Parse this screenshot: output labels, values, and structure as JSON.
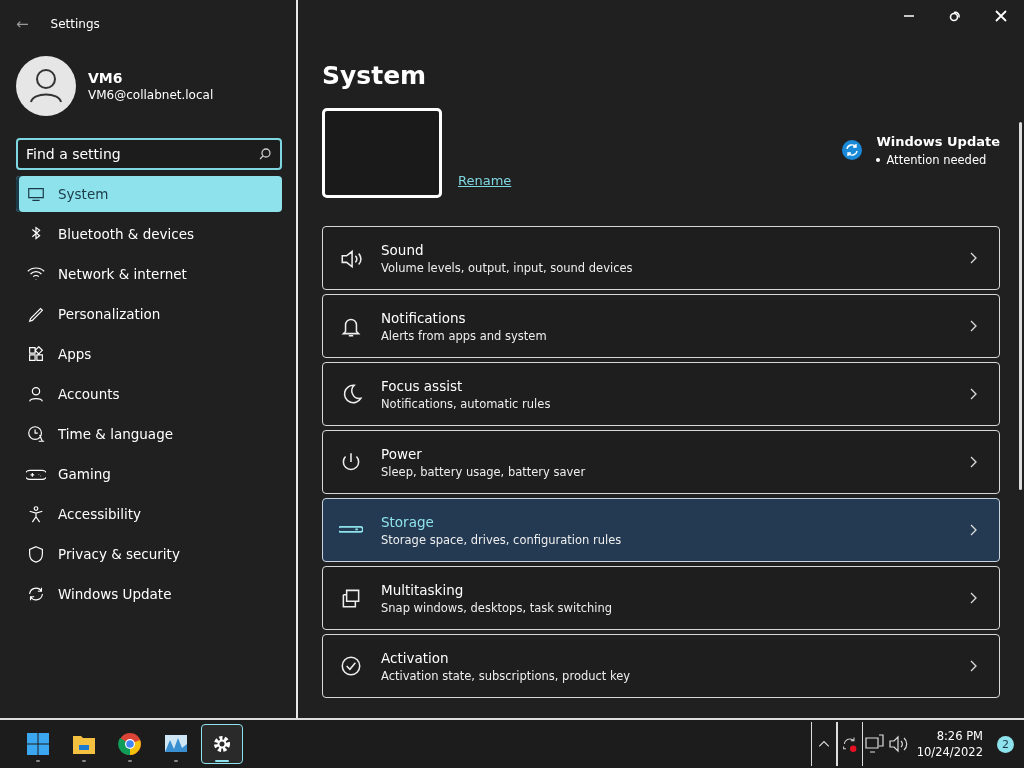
{
  "window": {
    "title": "Settings",
    "back": "←"
  },
  "account": {
    "name": "VM6",
    "email": "VM6@collabnet.local"
  },
  "search": {
    "placeholder": "Find a setting"
  },
  "nav": [
    {
      "label": "System",
      "selected": true
    },
    {
      "label": "Bluetooth & devices",
      "selected": false
    },
    {
      "label": "Network & internet",
      "selected": false
    },
    {
      "label": "Personalization",
      "selected": false
    },
    {
      "label": "Apps",
      "selected": false
    },
    {
      "label": "Accounts",
      "selected": false
    },
    {
      "label": "Time & language",
      "selected": false
    },
    {
      "label": "Gaming",
      "selected": false
    },
    {
      "label": "Accessibility",
      "selected": false
    },
    {
      "label": "Privacy & security",
      "selected": false
    },
    {
      "label": "Windows Update",
      "selected": false
    }
  ],
  "page": {
    "title": "System",
    "rename": "Rename"
  },
  "update": {
    "title": "Windows Update",
    "status": "Attention needed"
  },
  "cards": [
    {
      "title": "Sound",
      "subtitle": "Volume levels, output, input, sound devices",
      "selected": false
    },
    {
      "title": "Notifications",
      "subtitle": "Alerts from apps and system",
      "selected": false
    },
    {
      "title": "Focus assist",
      "subtitle": "Notifications, automatic rules",
      "selected": false
    },
    {
      "title": "Power",
      "subtitle": "Sleep, battery usage, battery saver",
      "selected": false
    },
    {
      "title": "Storage",
      "subtitle": "Storage space, drives, configuration rules",
      "selected": true
    },
    {
      "title": "Multitasking",
      "subtitle": "Snap windows, desktops, task switching",
      "selected": false
    },
    {
      "title": "Activation",
      "subtitle": "Activation state, subscriptions, product key",
      "selected": false
    }
  ],
  "taskbar": {
    "apps": [
      {
        "selected": false
      },
      {
        "selected": false
      },
      {
        "selected": false
      },
      {
        "selected": false
      },
      {
        "selected": true
      }
    ],
    "time": "8:26 PM",
    "date": "10/24/2022",
    "notifications": "2"
  }
}
